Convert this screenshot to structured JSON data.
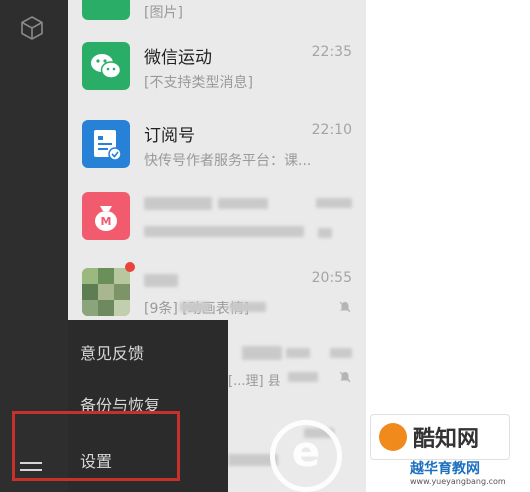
{
  "nav": {
    "top_icon": "cube-icon",
    "bottom_icon": "menu-icon"
  },
  "chats": [
    {
      "name": "",
      "preview": "[图片]",
      "time": "",
      "avatar_icon": "green-app-icon",
      "avatar_color": "#2aae67"
    },
    {
      "name": "微信运动",
      "preview": "[不支持类型消息]",
      "time": "22:35",
      "avatar_icon": "wechat-bubbles-icon",
      "avatar_color": "#2aae67"
    },
    {
      "name": "订阅号",
      "preview": "快传号作者服务平台：课...",
      "time": "22:10",
      "avatar_icon": "subscription-doc-icon",
      "avatar_color": "#2782d7"
    },
    {
      "name": "",
      "preview": "",
      "time": "",
      "avatar_icon": "money-bag-icon",
      "avatar_color": "#f25a6e"
    },
    {
      "name": "",
      "preview": "[9条]                [动画表情]",
      "time": "20:55",
      "avatar_icon": "group-photo-icon",
      "avatar_color": "#7ea06a"
    },
    {
      "name": "",
      "preview": "[...理] 县",
      "time": "",
      "avatar_icon": "blurred-avatar-icon",
      "avatar_color": "#cfcfcf"
    }
  ],
  "popup": {
    "items": [
      "意见反馈",
      "备份与恢复",
      "设置"
    ]
  },
  "watermark": {
    "brand": "酷知网",
    "site": "越华育教网",
    "url": "www.yueyangbang.com",
    "circle_letter": "e"
  }
}
